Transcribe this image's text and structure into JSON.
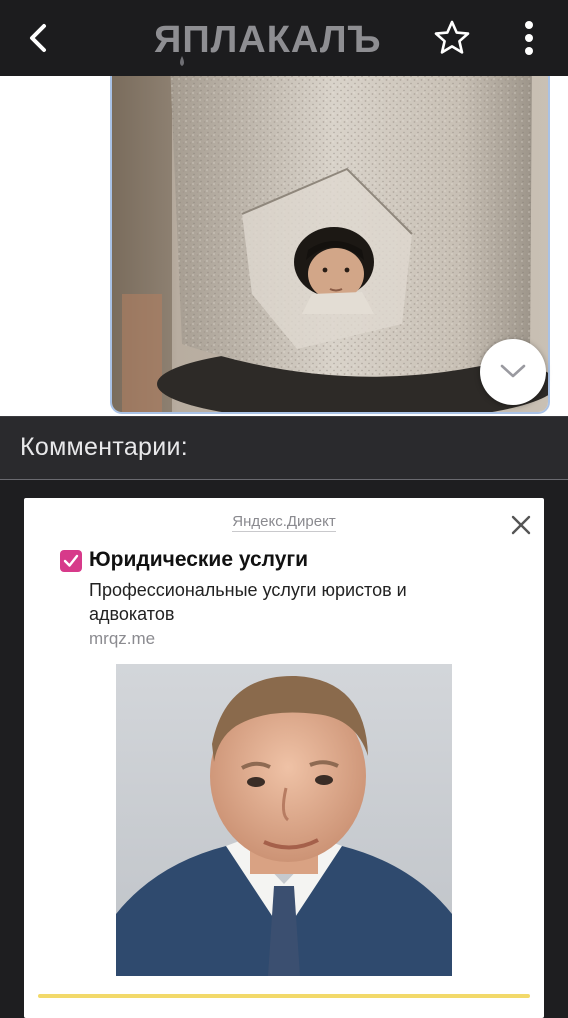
{
  "app": {
    "logo_text": "ЯПЛАКАЛЪ"
  },
  "icons": {
    "back": "chevron-left-icon",
    "star": "star-outline-icon",
    "more": "more-vertical-icon",
    "expand": "chevron-down-icon",
    "close": "close-icon",
    "check": "checkbox-checked-icon"
  },
  "colors": {
    "app_bar": "#1c1c1e",
    "comments_bar": "#2a2a2d",
    "ad_check": "#d73a8a"
  },
  "comments": {
    "title": "Комментарии:"
  },
  "ad": {
    "source": "Яндекс.Директ",
    "title": "Юридические услуги",
    "description": "Профессиональные услуги юристов и адвокатов",
    "domain": "mrqz.me"
  }
}
